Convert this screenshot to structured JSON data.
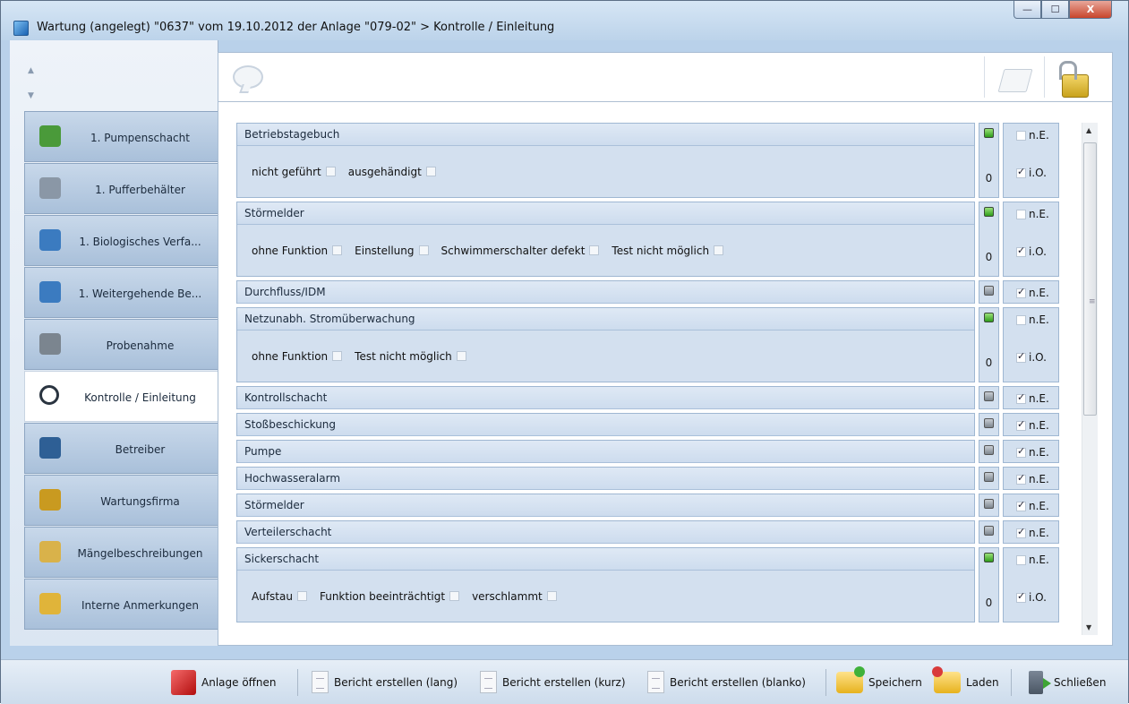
{
  "window": {
    "title": "Wartung (angelegt) \"0637\" vom 19.10.2012 der Anlage \"079-02\" > Kontrolle / Einleitung",
    "buttons": {
      "minimize": "—",
      "maximize": "☐",
      "close": "X"
    }
  },
  "sidebar": {
    "items": [
      {
        "label": "1. Pumpenschacht",
        "icon": "pump-shaft-icon"
      },
      {
        "label": "1. Pufferbehälter",
        "icon": "buffer-tank-icon"
      },
      {
        "label": "1. Biologisches Verfa...",
        "icon": "biological-process-icon"
      },
      {
        "label": "1. Weitergehende Be...",
        "icon": "further-treatment-icon"
      },
      {
        "label": "Probenahme",
        "icon": "sample-icon"
      },
      {
        "label": "Kontrolle / Einleitung",
        "icon": "magnifier-icon",
        "active": true
      },
      {
        "label": "Betreiber",
        "icon": "operator-icon"
      },
      {
        "label": "Wartungsfirma",
        "icon": "maintenance-company-icon"
      },
      {
        "label": "Mängelbeschreibungen",
        "icon": "defects-icon"
      },
      {
        "label": "Interne Anmerkungen",
        "icon": "notes-icon"
      }
    ]
  },
  "groups": [
    {
      "title": "Betriebstagebuch",
      "options": [
        "nicht geführt",
        "ausgehändigt"
      ],
      "status": "green",
      "count": "0",
      "check_ne": false,
      "check_io": true
    },
    {
      "title": "Störmelder",
      "options": [
        "ohne Funktion",
        "Einstellung",
        "Schwimmerschalter defekt",
        "Test nicht möglich"
      ],
      "status": "green",
      "count": "0",
      "check_ne": false,
      "check_io": true
    },
    {
      "title": "Durchfluss/IDM",
      "status": "gray",
      "check_ne": true
    },
    {
      "title": "Netzunabh. Stromüberwachung",
      "options": [
        "ohne Funktion",
        "Test nicht möglich"
      ],
      "status": "green",
      "count": "0",
      "check_ne": false,
      "check_io": true
    },
    {
      "title": "Kontrollschacht",
      "status": "gray",
      "check_ne": true
    },
    {
      "title": "Stoßbeschickung",
      "status": "gray",
      "check_ne": true
    },
    {
      "title": "Pumpe",
      "status": "gray",
      "check_ne": true
    },
    {
      "title": "Hochwasseralarm",
      "status": "gray",
      "check_ne": true
    },
    {
      "title": "Störmelder",
      "status": "gray",
      "check_ne": true
    },
    {
      "title": "Verteilerschacht",
      "status": "gray",
      "check_ne": true
    },
    {
      "title": "Sickerschacht",
      "options": [
        "Aufstau",
        "Funktion beeinträchtigt",
        "verschlammt"
      ],
      "status": "green",
      "count": "0",
      "check_ne": false,
      "check_io": true
    }
  ],
  "labels": {
    "ne": "n.E.",
    "io": "i.O."
  },
  "toolbar": {
    "open_label": "Anlage öffnen",
    "report_long": "Bericht erstellen (lang)",
    "report_short": "Bericht erstellen (kurz)",
    "report_blank": "Bericht erstellen (blanko)",
    "save_label": "Speichern",
    "load_label": "Laden",
    "close_label": "Schließen"
  }
}
